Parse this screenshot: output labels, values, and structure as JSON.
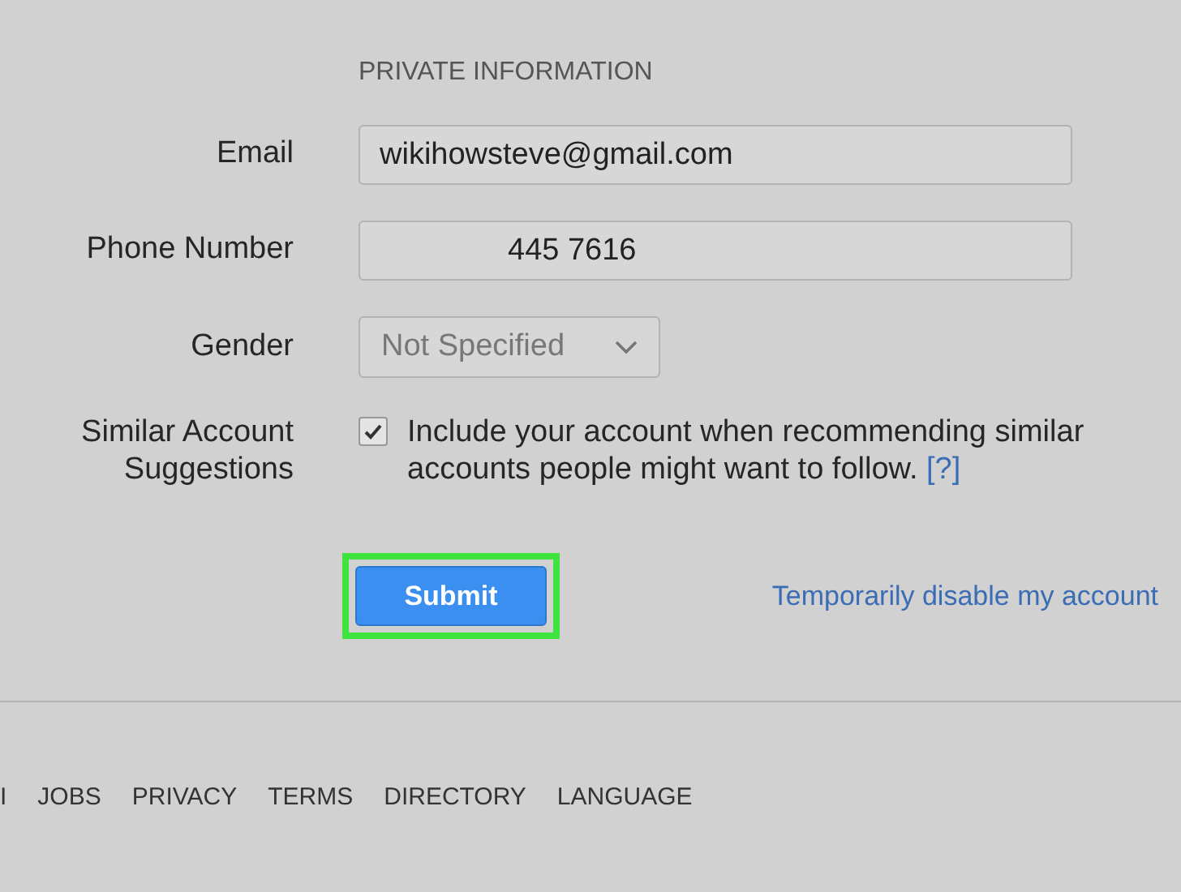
{
  "section_title": "PRIVATE INFORMATION",
  "fields": [
    {
      "kind": "text",
      "label": "Email",
      "value": "wikihowsteve@gmail.com"
    },
    {
      "kind": "text",
      "label": "Phone Number",
      "value": "445 7616"
    },
    {
      "kind": "select",
      "label": "Gender",
      "value": "Not Specified"
    },
    {
      "kind": "checkbox",
      "label": "Similar Account Suggestions",
      "checked": true,
      "text": "Include your account when recommending similar accounts people might want to follow.",
      "help_link": "[?]"
    }
  ],
  "submit": {
    "label": "Submit",
    "highlighted": true
  },
  "disable_link": "Temporarily disable my account",
  "footer_links": [
    "I",
    "JOBS",
    "PRIVACY",
    "TERMS",
    "DIRECTORY",
    "LANGUAGE"
  ]
}
